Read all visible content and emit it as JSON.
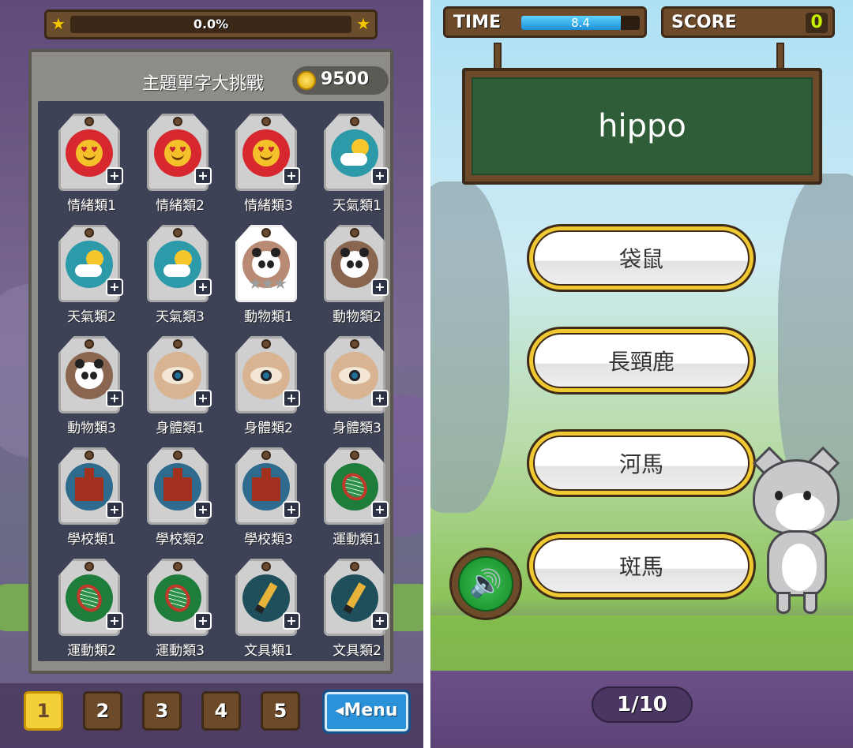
{
  "left_screen": {
    "progress": {
      "text": "0.0%",
      "value": 0.0
    },
    "header": {
      "title": "主題單字大挑戰",
      "coins": "9500"
    },
    "tiles": [
      {
        "label": "情緒類1",
        "icon": "smiley-face-icon",
        "disc_color": "#d7282f",
        "selected": false
      },
      {
        "label": "情緒類2",
        "icon": "smiley-face-icon",
        "disc_color": "#d7282f",
        "selected": false
      },
      {
        "label": "情緒類3",
        "icon": "smiley-face-icon",
        "disc_color": "#d7282f",
        "selected": false
      },
      {
        "label": "天氣類1",
        "icon": "sun-cloud-icon",
        "disc_color": "#2c9aa8",
        "selected": false
      },
      {
        "label": "天氣類2",
        "icon": "sun-cloud-icon",
        "disc_color": "#2c9aa8",
        "selected": false
      },
      {
        "label": "天氣類3",
        "icon": "sun-cloud-icon",
        "disc_color": "#2c9aa8",
        "selected": false
      },
      {
        "label": "動物類1",
        "icon": "panda-icon",
        "disc_color": "#b98a74",
        "selected": true
      },
      {
        "label": "動物類2",
        "icon": "panda-icon",
        "disc_color": "#8a6650",
        "selected": false
      },
      {
        "label": "動物類3",
        "icon": "panda-icon",
        "disc_color": "#8a6650",
        "selected": false
      },
      {
        "label": "身體類1",
        "icon": "eye-icon",
        "disc_color": "#d9b493",
        "selected": false
      },
      {
        "label": "身體類2",
        "icon": "eye-icon",
        "disc_color": "#d9b493",
        "selected": false
      },
      {
        "label": "身體類3",
        "icon": "eye-icon",
        "disc_color": "#d9b493",
        "selected": false
      },
      {
        "label": "學校類1",
        "icon": "school-icon",
        "disc_color": "#2f6b8e",
        "selected": false
      },
      {
        "label": "學校類2",
        "icon": "school-icon",
        "disc_color": "#2f6b8e",
        "selected": false
      },
      {
        "label": "學校類3",
        "icon": "school-icon",
        "disc_color": "#2f6b8e",
        "selected": false
      },
      {
        "label": "運動類1",
        "icon": "tennis-racket-icon",
        "disc_color": "#1f7d3c",
        "selected": false
      },
      {
        "label": "運動類2",
        "icon": "tennis-racket-icon",
        "disc_color": "#1f7d3c",
        "selected": false
      },
      {
        "label": "運動類3",
        "icon": "tennis-racket-icon",
        "disc_color": "#1f7d3c",
        "selected": false
      },
      {
        "label": "文具類1",
        "icon": "pencil-icon",
        "disc_color": "#1f4f5a",
        "selected": false
      },
      {
        "label": "文具類2",
        "icon": "pencil-icon",
        "disc_color": "#1f4f5a",
        "selected": false
      }
    ],
    "pager": {
      "pages": [
        "1",
        "2",
        "3",
        "4",
        "5"
      ],
      "active": "1",
      "menu_label": "◂Menu"
    }
  },
  "right_screen": {
    "hud": {
      "time_label": "TIME",
      "time_value": "8.4",
      "time_fraction": 0.84,
      "score_label": "SCORE",
      "score_value": "0"
    },
    "word": "hippo",
    "answers": [
      "袋鼠",
      "長頸鹿",
      "河馬",
      "斑馬"
    ],
    "counter": "1/10"
  }
}
